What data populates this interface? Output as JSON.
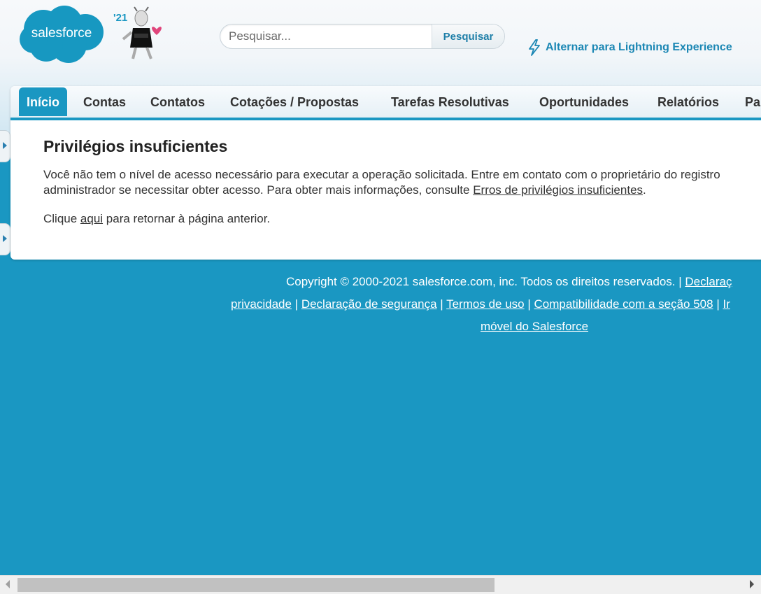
{
  "header": {
    "logo_text": "salesforce",
    "release_badge": "'21",
    "search": {
      "placeholder": "Pesquisar...",
      "value": "",
      "button_label": "Pesquisar"
    },
    "lightning_link": "Alternar para Lightning Experience"
  },
  "tabs": [
    {
      "label": "Início",
      "active": true
    },
    {
      "label": "Contas"
    },
    {
      "label": "Contatos"
    },
    {
      "label": "Cotações / Propostas"
    },
    {
      "label": "Tarefas Resolutivas"
    },
    {
      "label": "Oportunidades"
    },
    {
      "label": "Relatórios"
    },
    {
      "label": "Pa"
    }
  ],
  "content": {
    "title": "Privilégios insuficientes",
    "line1": "Você não tem o nível de acesso necessário para executar a operação solicitada. Entre em contato com o proprietário do registro",
    "line2_prefix": "administrador se necessitar obter acesso. Para obter mais informações, consulte ",
    "line2_link": "Erros de privilégios insuficientes",
    "line2_suffix": ".",
    "back_prefix": "Clique ",
    "back_link": "aqui",
    "back_suffix": " para retornar à página anterior."
  },
  "footer": {
    "copyright": "Copyright © 2000-2021 salesforce.com, inc. Todos os direitos reservados. | ",
    "link_declaracao": "Declaraç",
    "link_privacidade": "privacidade",
    "sep": " | ",
    "link_seguranca": "Declaração de segurança",
    "link_termos": "Termos de uso",
    "link_508": "Compatibilidade com a seção 508",
    "link_ir": "Ir",
    "link_movel": "móvel do Salesforce"
  },
  "colors": {
    "brand_blue": "#1a97c2",
    "link_blue": "#1b87b4"
  }
}
